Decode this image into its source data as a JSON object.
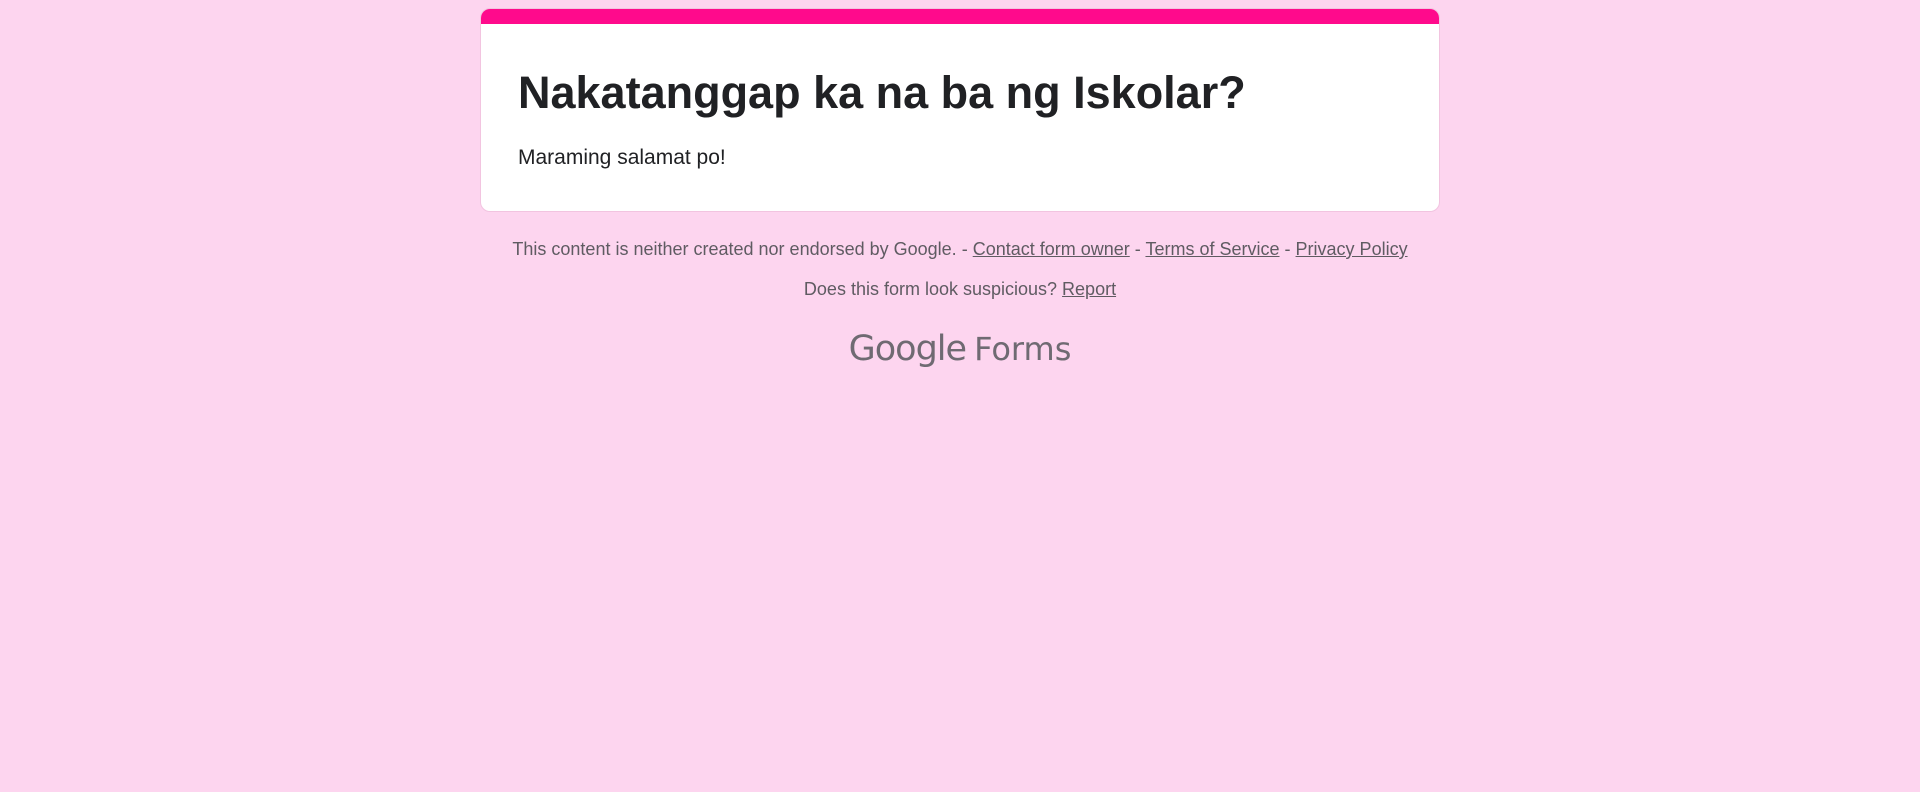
{
  "form": {
    "title": "Nakatanggap ka na ba ng Iskolar?",
    "message": "Maraming salamat po!"
  },
  "footer": {
    "disclaimer": "This content is neither created nor endorsed by Google.",
    "separator": "-",
    "contact_label": "Contact form owner",
    "terms_label": "Terms of Service",
    "privacy_label": "Privacy Policy",
    "suspicious_prompt": "Does this form look suspicious?",
    "report_label": "Report"
  },
  "brand": {
    "google": "Google",
    "forms": "Forms"
  },
  "colors": {
    "background": "#fdd5ef",
    "accent": "#ff0a8c",
    "card": "#ffffff",
    "footer_text": "#5f5b62"
  }
}
